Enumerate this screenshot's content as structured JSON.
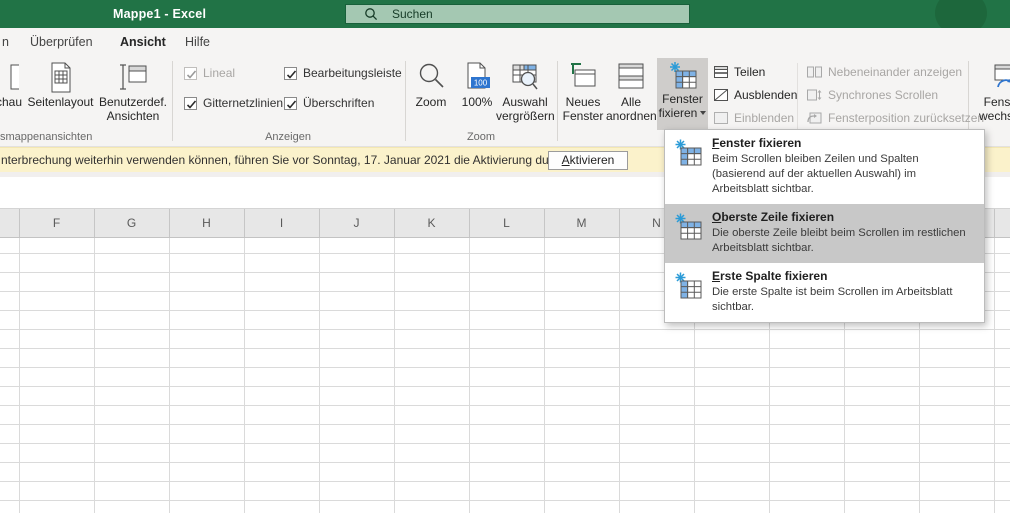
{
  "colors": {
    "excel_green": "#217346",
    "search_fill": "#a4c8b2",
    "notif_yellow": "#fbf2cb",
    "menu_highlight": "#c8c8c8",
    "freeze_blue": "#7fb2e5",
    "accent_blue": "#2e75cf"
  },
  "titlebar": {
    "title": "Mappe1 - Excel",
    "search_placeholder": "Suchen"
  },
  "tab_bar": {
    "partial_tab": "n",
    "tabs": [
      {
        "label": "Überprüfen"
      },
      {
        "label": "Ansicht"
      },
      {
        "label": "Hilfe"
      }
    ],
    "active_tab": "Ansicht"
  },
  "ribbon": {
    "workbook_views_group": {
      "label": "smappenansichten",
      "partial_button": "schau",
      "buttons": [
        "Seitenlayout",
        "Benutzerdef. Ansichten"
      ]
    },
    "anzeigen_group": {
      "label": "Anzeigen",
      "checkboxes": [
        {
          "label": "Lineal",
          "checked": true,
          "disabled": true
        },
        {
          "label": "Bearbeitungsleiste",
          "checked": true,
          "disabled": false
        },
        {
          "label": "Gitternetzlinien",
          "checked": true,
          "disabled": false
        },
        {
          "label": "Überschriften",
          "checked": true,
          "disabled": false
        }
      ]
    },
    "zoom_group": {
      "label": "Zoom",
      "buttons": [
        "Zoom",
        "100%",
        "Auswahl vergrößern"
      ],
      "badge_100": "100"
    },
    "window_group": {
      "neues_fenster": "Neues Fenster",
      "alle_anordnen": "Alle anordnen",
      "fenster_fixieren_line1": "Fenster",
      "fenster_fixieren_line2": "fixieren",
      "teilen": "Teilen",
      "ausblenden": "Ausblenden",
      "einblenden": "Einblenden",
      "nebeneinander": "Nebeneinander anzeigen",
      "synchron": "Synchrones Scrollen",
      "fensterposition": "Fensterposition zurücksetzen"
    },
    "fenster_wechseln": "Fenster wechseln"
  },
  "notification": {
    "message": "nterbrechung weiterhin verwenden können, führen Sie vor Sonntag, 17. Januar 2021 die Aktivierung durch.",
    "button_accel": "A",
    "button_rest": "ktivieren"
  },
  "freeze_menu": {
    "items": [
      {
        "accel": "F",
        "rest": "enster fixieren",
        "desc": "Beim Scrollen bleiben Zeilen und Spalten (basierend auf der aktuellen Auswahl) im Arbeitsblatt sichtbar.",
        "highlighted": false
      },
      {
        "accel": "O",
        "rest": "berste Zeile fixieren",
        "desc": "Die oberste Zeile bleibt beim Scrollen im restlichen Arbeitsblatt sichtbar.",
        "highlighted": true
      },
      {
        "accel": "E",
        "rest": "rste Spalte fixieren",
        "desc": "Die erste Spalte ist beim Scrollen im Arbeitsblatt sichtbar.",
        "highlighted": false
      }
    ]
  },
  "grid": {
    "column_headers": [
      "F",
      "G",
      "H",
      "I",
      "J",
      "K",
      "L",
      "M",
      "N"
    ]
  }
}
